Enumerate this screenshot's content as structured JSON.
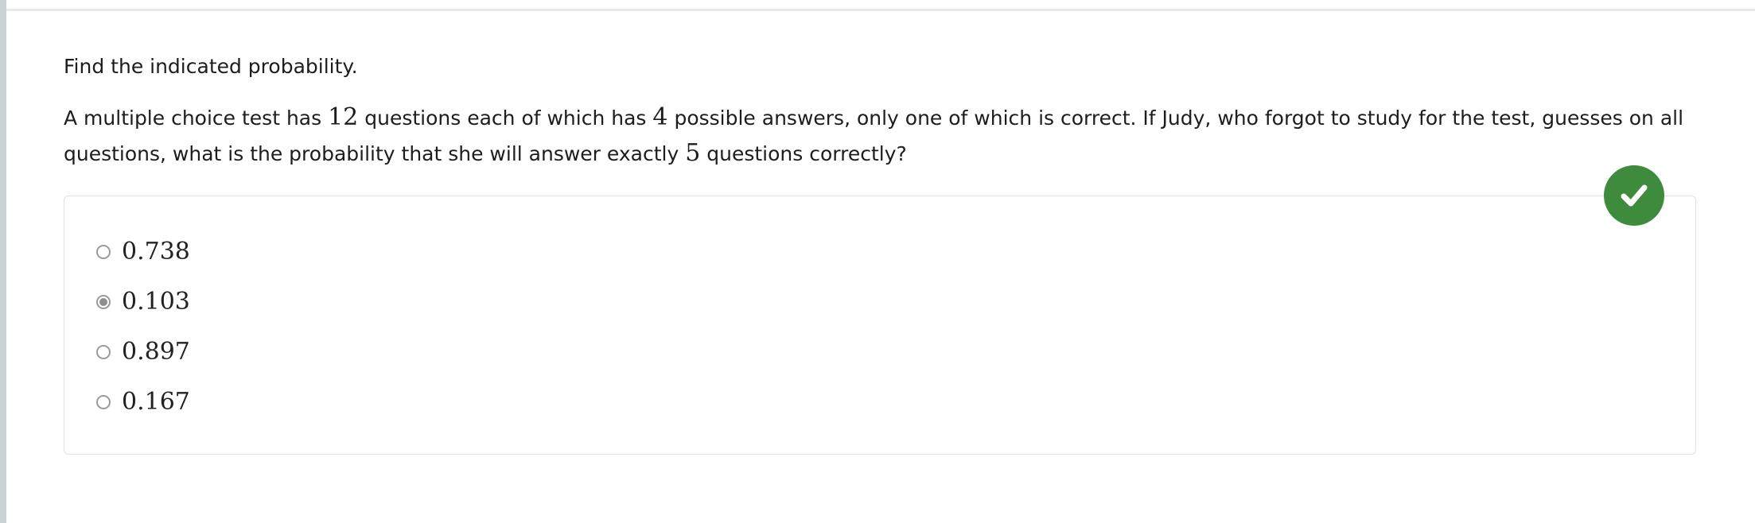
{
  "prompt": {
    "instruction": "Find the indicated probability."
  },
  "question": {
    "text_1": "A multiple choice test has ",
    "question_count": "12",
    "text_2": " questions each of which has ",
    "option_count": "4",
    "text_3": " possible answers, only one of which is correct. If Judy, who forgot to study for the test, guesses on all questions, what is the probability that she will answer exactly ",
    "correct_count": "5",
    "text_4": " questions correctly?"
  },
  "choices": [
    {
      "label": "0.738",
      "selected": false
    },
    {
      "label": "0.103",
      "selected": true
    },
    {
      "label": "0.897",
      "selected": false
    },
    {
      "label": "0.167",
      "selected": false
    }
  ],
  "feedback": {
    "status": "correct",
    "icon": "checkmark-icon",
    "color": "#3f8b3d"
  }
}
